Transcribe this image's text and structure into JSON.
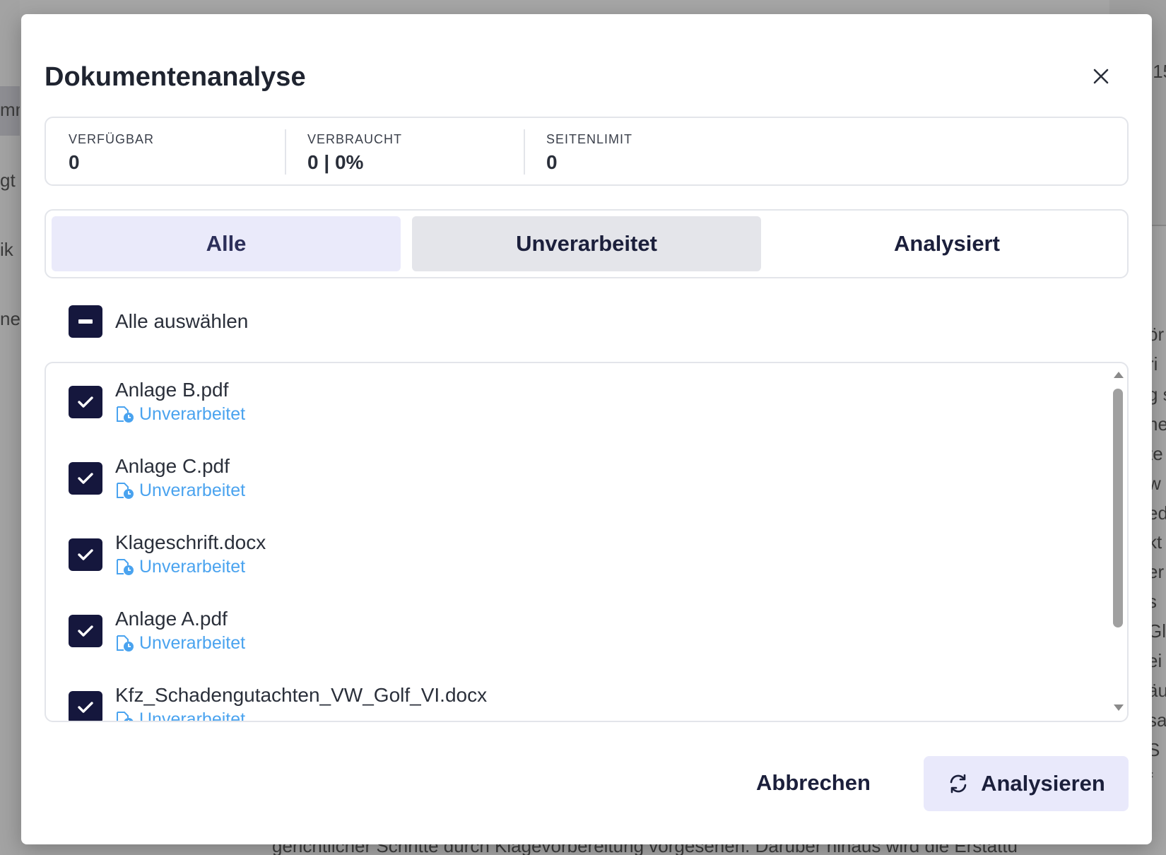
{
  "background": {
    "sidebar_fragments": [
      "mm",
      "gt",
      "ik",
      "ne"
    ],
    "right_fragments": [
      ":15",
      "ör",
      "ri",
      "g s",
      "he",
      "te",
      "w",
      "ed",
      "kt",
      "er",
      "s",
      "Gl",
      "ei",
      "äu",
      "sa",
      "S",
      "f"
    ],
    "bottom_text": "gerichtlicher Schritte durch Klagevorbereitung vorgesehen. Darüber hinaus wird die Erstattu"
  },
  "dialog": {
    "title": "Dokumentenanalyse",
    "close_icon": "close-icon",
    "stats": [
      {
        "label": "VERFÜGBAR",
        "value": "0"
      },
      {
        "label": "VERBRAUCHT",
        "value": "0 | 0%"
      },
      {
        "label": "SEITENLIMIT",
        "value": "0"
      }
    ],
    "tabs": [
      {
        "label": "Alle",
        "state": "active"
      },
      {
        "label": "Unverarbeitet",
        "state": "hover"
      },
      {
        "label": "Analysiert",
        "state": "default"
      }
    ],
    "select_all": {
      "label": "Alle auswählen",
      "state": "indeterminate"
    },
    "files": [
      {
        "name": "Anlage B.pdf",
        "status": "Unverarbeitet",
        "checked": true
      },
      {
        "name": "Anlage C.pdf",
        "status": "Unverarbeitet",
        "checked": true
      },
      {
        "name": "Klageschrift.docx",
        "status": "Unverarbeitet",
        "checked": true
      },
      {
        "name": "Anlage A.pdf",
        "status": "Unverarbeitet",
        "checked": true
      },
      {
        "name": "Kfz_Schadengutachten_VW_Golf_VI.docx",
        "status": "Unverarbeitet",
        "checked": true
      }
    ],
    "footer": {
      "cancel_label": "Abbrechen",
      "analyze_label": "Analysieren",
      "analyze_icon": "refresh-icon"
    }
  },
  "colors": {
    "primary": "#15173d",
    "status": "#4aa3ef",
    "active_tab": "#eaeafa",
    "analyze_button": "#e9e9fb"
  }
}
